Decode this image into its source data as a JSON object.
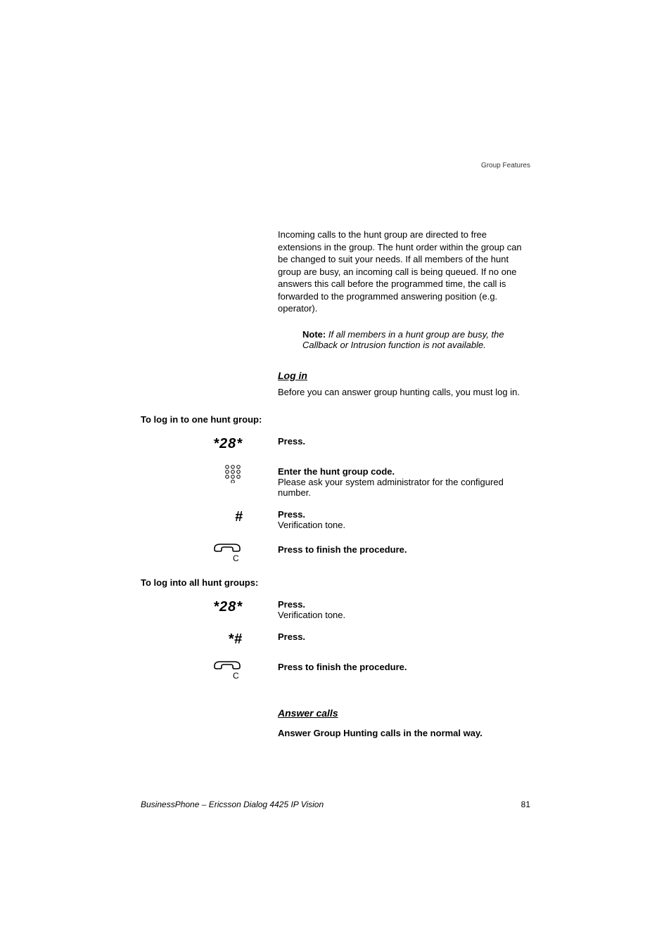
{
  "header": {
    "section": "Group Features"
  },
  "intro": {
    "paragraph": "Incoming calls to the hunt group are directed to free extensions in the group. The hunt order within the group can be changed to suit your needs. If all members of the hunt group are busy, an incoming call is being queued. If no one answers this call before the programmed time, the call is forwarded to the programmed answering position (e.g. operator)."
  },
  "note": {
    "label": "Note:",
    "text": " If all members in a hunt group are busy, the Callback or Intrusion function is not available."
  },
  "login": {
    "heading": "Log in",
    "intro": "Before you can answer group hunting calls, you must log in.",
    "one_group_label": "To log in to one hunt group:",
    "all_groups_label": "To log into all hunt groups:",
    "seq1": "*28*",
    "seq2": "*28*",
    "seq3": "*#",
    "hash": "#",
    "press": "Press.",
    "enter_code_bold": "Enter the hunt group code.",
    "enter_code_sub": "Please ask your system administrator for the configured number.",
    "verification": "Verification tone.",
    "press_finish": "Press to finish the procedure."
  },
  "answer": {
    "heading": "Answer calls",
    "line": "Answer Group Hunting calls in the normal way."
  },
  "footer": {
    "title": "BusinessPhone – Ericsson Dialog 4425 IP Vision",
    "page": "81"
  },
  "icons": {
    "keypad": "keypad-icon",
    "clear": "clear-handset-icon"
  }
}
